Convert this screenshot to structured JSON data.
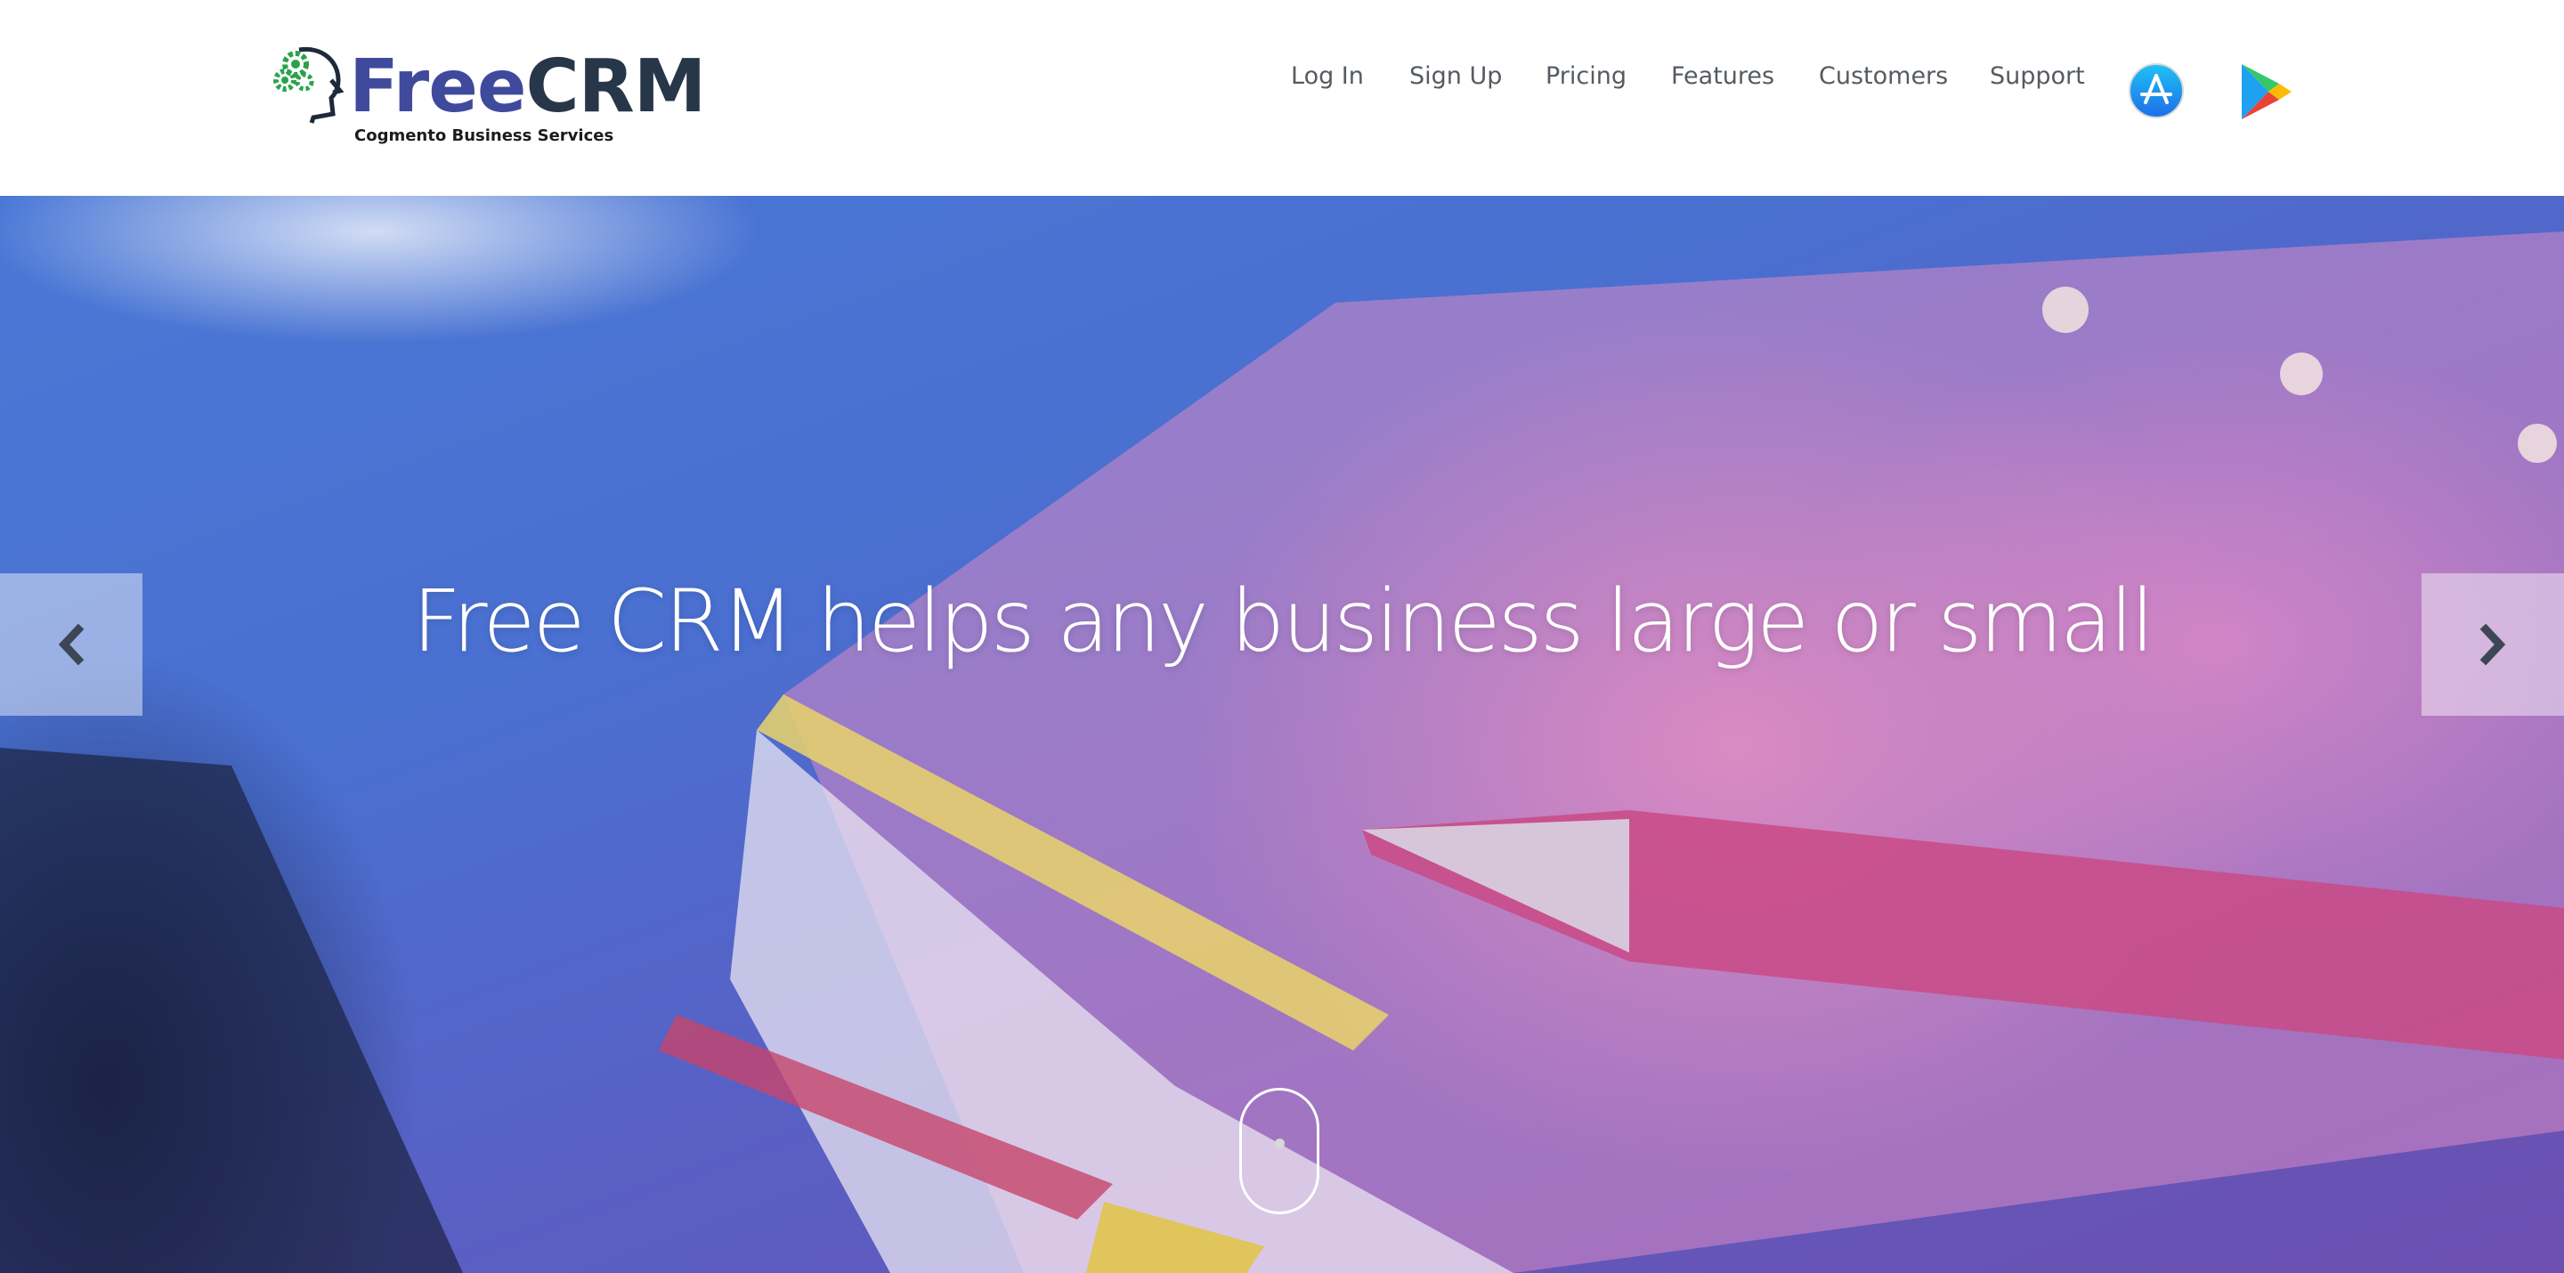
{
  "brand": {
    "name_part1": "Free",
    "name_part2": "CRM",
    "tagline": "Cogmento Business Services"
  },
  "nav": {
    "items": [
      {
        "label": "Log In"
      },
      {
        "label": "Sign Up"
      },
      {
        "label": "Pricing"
      },
      {
        "label": "Features"
      },
      {
        "label": "Customers"
      },
      {
        "label": "Support"
      }
    ],
    "app_store_icon": "app-store-icon",
    "play_store_icon": "google-play-icon"
  },
  "hero": {
    "title": "Free CRM helps any business large or small",
    "prev_icon": "chevron-left-icon",
    "next_icon": "chevron-right-icon",
    "scroll_icon": "mouse-scroll-icon"
  },
  "colors": {
    "brand_free": "#3f4a9d",
    "brand_crm": "#28364a",
    "nav_text": "#555b61",
    "hero_text": "#ffffff"
  }
}
